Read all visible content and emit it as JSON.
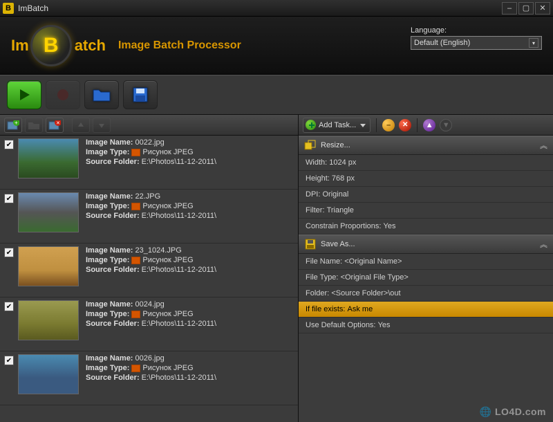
{
  "titlebar": {
    "appicon": "B",
    "title": "ImBatch"
  },
  "header": {
    "logo_im": "Im",
    "logo_b": "B",
    "logo_atch": "atch",
    "subtitle": "Image Batch Processor",
    "language_label": "Language:",
    "language_value": "Default (English)"
  },
  "filebar": {
    "add": "add-images",
    "add2": "add-folder",
    "remove": "remove-image",
    "up": "move-up",
    "down": "move-down"
  },
  "labels": {
    "name": "Image Name:",
    "type": "Image Type:",
    "folder": "Source Folder:",
    "type_value": "Рисунок JPEG"
  },
  "images": [
    {
      "name": "0022.jpg",
      "folder": "E:\\Photos\\11-12-2011\\",
      "thumb": "t1"
    },
    {
      "name": "22.JPG",
      "folder": "E:\\Photos\\11-12-2011\\",
      "thumb": "t2"
    },
    {
      "name": "23_1024.JPG",
      "folder": "E:\\Photos\\11-12-2011\\",
      "thumb": "t3"
    },
    {
      "name": "0024.jpg",
      "folder": "E:\\Photos\\11-12-2011\\",
      "thumb": "t4"
    },
    {
      "name": "0026.jpg",
      "folder": "E:\\Photos\\11-12-2011\\",
      "thumb": "t5"
    }
  ],
  "taskbar": {
    "add_label": "Add Task..."
  },
  "tasks": {
    "resize": {
      "title": "Resize...",
      "params": [
        {
          "label": "Width:",
          "value": "1024 px"
        },
        {
          "label": "Height:",
          "value": "768 px"
        },
        {
          "label": "DPI:",
          "value": "Original"
        },
        {
          "label": "Filter:",
          "value": "Triangle"
        },
        {
          "label": "Constrain Proportions:",
          "value": "Yes"
        }
      ]
    },
    "saveas": {
      "title": "Save As...",
      "params": [
        {
          "label": "File Name:",
          "value": "<Original Name>",
          "sel": false
        },
        {
          "label": "File Type:",
          "value": "<Original File Type>",
          "sel": false
        },
        {
          "label": "Folder:",
          "value": "<Source Folder>\\out",
          "sel": false
        },
        {
          "label": "If file exists:",
          "value": "Ask me",
          "sel": true
        },
        {
          "label": "Use Default Options:",
          "value": "Yes",
          "sel": false
        }
      ]
    }
  },
  "watermark": "LO4D.com"
}
